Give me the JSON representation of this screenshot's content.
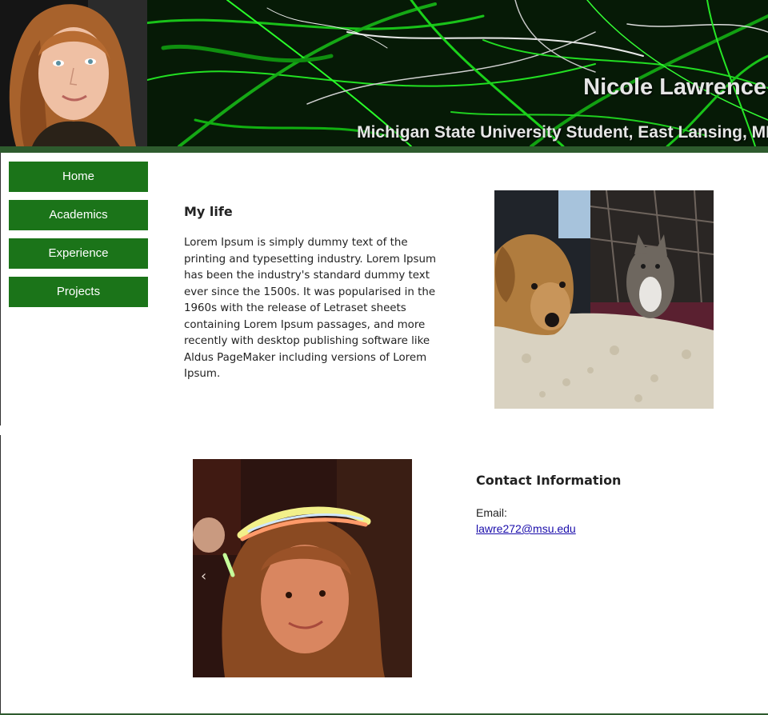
{
  "header": {
    "site_name": "Nicole Lawrence",
    "tagline": "Michigan State University Student, East Lansing, MI"
  },
  "nav": {
    "items": [
      {
        "label": "Home"
      },
      {
        "label": "Academics"
      },
      {
        "label": "Experience"
      },
      {
        "label": "Projects"
      }
    ]
  },
  "about": {
    "heading": "My life",
    "body": "Lorem Ipsum is simply dummy text of the printing and typesetting industry. Lorem Ipsum has been the industry's standard dummy text ever since the 1500s. It was popularised in the 1960s with the release of Letraset sheets containing Lorem Ipsum passages, and more recently with desktop publishing software like Aldus PageMaker including versions of Lorem Ipsum."
  },
  "contact": {
    "heading": "Contact Information",
    "email_label": "Email:",
    "email": "lawre272@msu.edu"
  },
  "colors": {
    "nav_button": "#1b7419",
    "header_rule": "#2e5b2e",
    "link": "#1a0dab"
  }
}
